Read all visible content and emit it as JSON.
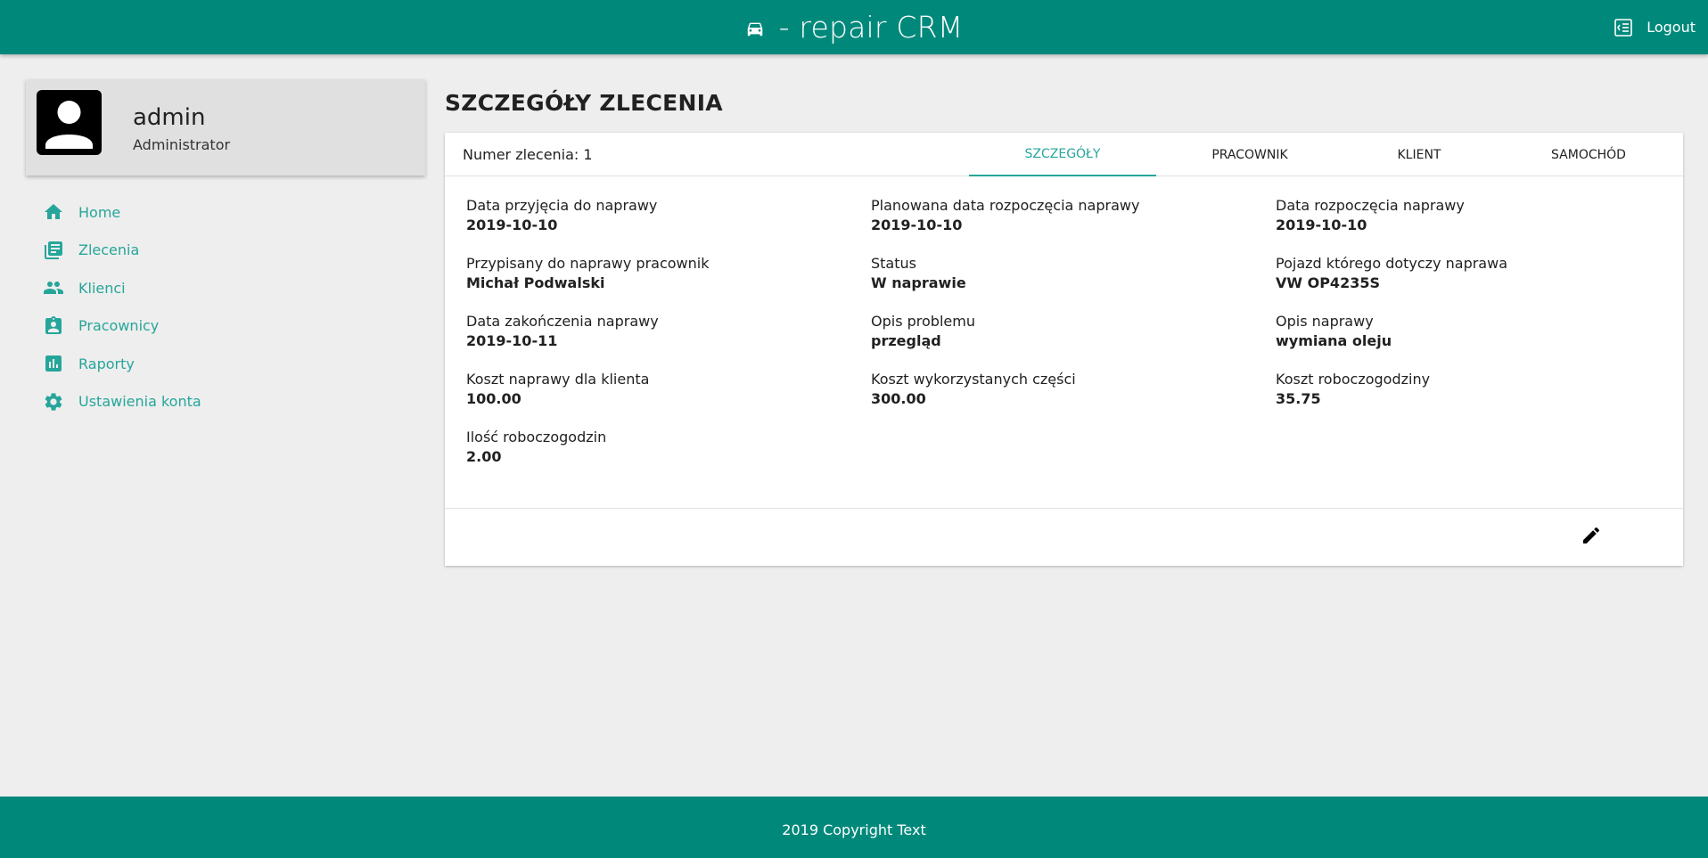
{
  "header": {
    "title": "- repair CRM",
    "logout_label": "Logout",
    "brand_icon": "car-icon",
    "logout_icon": "logout-icon"
  },
  "colors": {
    "primary": "#00897b",
    "accent": "#26a69a",
    "background": "#eeeeee",
    "profile_card": "#e0e0e0"
  },
  "profile": {
    "name": "admin",
    "role": "Administrator",
    "icon": "account-icon"
  },
  "sidebar": {
    "items": [
      {
        "label": "Home",
        "icon": "home-icon"
      },
      {
        "label": "Zlecenia",
        "icon": "library-books-icon"
      },
      {
        "label": "Klienci",
        "icon": "people-icon"
      },
      {
        "label": "Pracownicy",
        "icon": "assignment-ind-icon"
      },
      {
        "label": "Raporty",
        "icon": "assessment-icon"
      },
      {
        "label": "Ustawienia konta",
        "icon": "settings-icon"
      }
    ]
  },
  "main": {
    "page_title": "SZCZEGÓŁY ZLECENIA",
    "order_number": "Numer zlecenia: 1",
    "tabs": [
      {
        "label": "SZCZEGÓŁY",
        "active": true
      },
      {
        "label": "PRACOWNIK",
        "active": false
      },
      {
        "label": "KLIENT",
        "active": false
      },
      {
        "label": "SAMOCHÓD",
        "active": false
      }
    ],
    "fields": [
      {
        "label": "Data przyjęcia do naprawy",
        "value": "2019-10-10"
      },
      {
        "label": "Planowana data rozpoczęcia naprawy",
        "value": "2019-10-10"
      },
      {
        "label": "Data rozpoczęcia naprawy",
        "value": "2019-10-10"
      },
      {
        "label": "Przypisany do naprawy pracownik",
        "value": "Michał Podwalski"
      },
      {
        "label": "Status",
        "value": "W naprawie"
      },
      {
        "label": "Pojazd którego dotyczy naprawa",
        "value": "VW OP4235S"
      },
      {
        "label": "Data zakończenia naprawy",
        "value": "2019-10-11"
      },
      {
        "label": "Opis problemu",
        "value": "przegląd"
      },
      {
        "label": "Opis naprawy",
        "value": "wymiana oleju"
      },
      {
        "label": "Koszt naprawy dla klienta",
        "value": "100.00"
      },
      {
        "label": "Koszt wykorzystanych części",
        "value": "300.00"
      },
      {
        "label": "Koszt roboczogodziny",
        "value": "35.75"
      },
      {
        "label": "Ilość roboczogodzin",
        "value": "2.00"
      }
    ],
    "edit_icon": "edit-icon"
  },
  "footer": {
    "text": "2019 Copyright Text"
  }
}
